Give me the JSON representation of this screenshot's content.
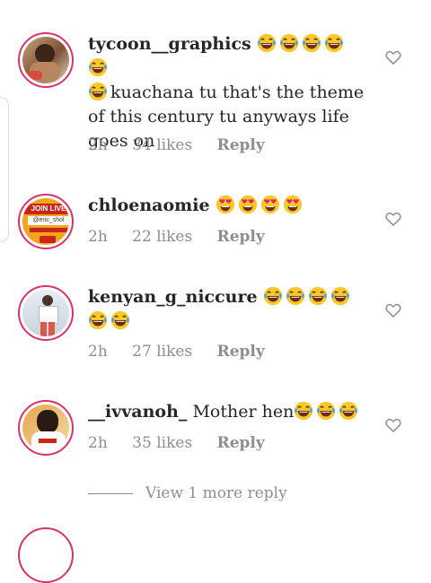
{
  "comments": [
    {
      "username": "tycoon__graphics",
      "text": "kuachana tu that's the theme of this century tu anyways life goes on",
      "time": "2h",
      "likes": "34 likes",
      "reply": "Reply"
    },
    {
      "username": "chloenaomie",
      "time": "2h",
      "likes": "22 likes",
      "reply": "Reply",
      "avatar_text_1": "JOIN LIVE",
      "avatar_text_2": "@eric_shol"
    },
    {
      "username": "kenyan_g_niccure",
      "time": "2h",
      "likes": "27 likes",
      "reply": "Reply"
    },
    {
      "username": "__ivvanoh_",
      "text": "Mother hen",
      "time": "2h",
      "likes": "35 likes",
      "reply": "Reply"
    }
  ],
  "view_more": "View 1 more reply",
  "icons": {
    "laugh_emoji": "face-with-tears-of-joy-icon",
    "heart_eyes_emoji": "smiling-face-with-heart-eyes-icon",
    "like": "heart-outline-icon"
  },
  "colors": {
    "story_ring": "#d6336c",
    "meta_text": "#8e8e8e",
    "emoji_yellow": "#f7c72b"
  }
}
